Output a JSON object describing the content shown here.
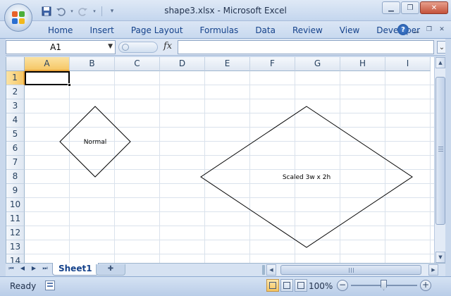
{
  "window": {
    "title": "shape3.xlsx - Microsoft Excel"
  },
  "qat": {
    "save_icon": "save-icon",
    "undo_icon": "undo-icon",
    "redo_icon": "redo-icon",
    "customize_icon": "customize-icon"
  },
  "ribbon": {
    "tabs": [
      "Home",
      "Insert",
      "Page Layout",
      "Formulas",
      "Data",
      "Review",
      "View",
      "Developer"
    ]
  },
  "formula_bar": {
    "name_box": "A1",
    "fx": "fx",
    "value": ""
  },
  "grid": {
    "columns": [
      "A",
      "B",
      "C",
      "D",
      "E",
      "F",
      "G",
      "H",
      "I"
    ],
    "rows": [
      "1",
      "2",
      "3",
      "4",
      "5",
      "6",
      "7",
      "8",
      "9",
      "10",
      "11",
      "12",
      "13",
      "14"
    ],
    "selected_column": "A",
    "selected_row": "1"
  },
  "shapes": [
    {
      "label": "Normal"
    },
    {
      "label": "Scaled 3w x 2h"
    }
  ],
  "sheets": {
    "tabs": [
      "Sheet1"
    ]
  },
  "status": {
    "text": "Ready",
    "zoom": "100%"
  },
  "colors": {
    "accent": "#15428b",
    "selection": "#f6c766",
    "frame": "#c9d8ec"
  }
}
